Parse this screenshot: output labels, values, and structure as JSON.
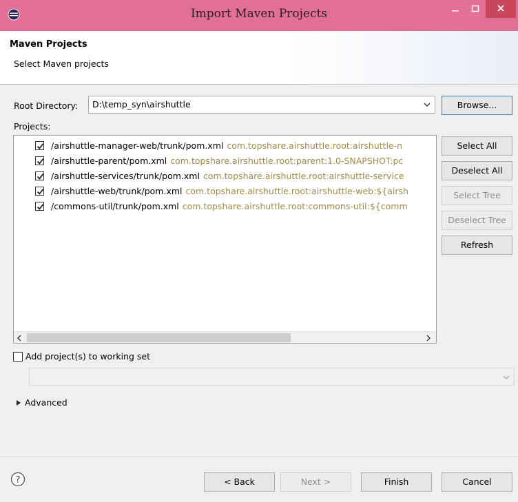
{
  "window": {
    "title": "Import Maven Projects"
  },
  "header": {
    "title": "Maven Projects",
    "subtitle": "Select Maven projects"
  },
  "root_directory": {
    "label": "Root Directory:",
    "value": "D:\\temp_syn\\airshuttle",
    "browse_label": "Browse..."
  },
  "projects": {
    "label": "Projects:",
    "items": [
      {
        "path": "/airshuttle-manager-web/trunk/pom.xml",
        "artifact": "com.topshare.airshuttle.root:airshuttle-n",
        "checked": true
      },
      {
        "path": "/airshuttle-parent/pom.xml",
        "artifact": "com.topshare.airshuttle.root:parent:1.0-SNAPSHOT:pc",
        "checked": true
      },
      {
        "path": "/airshuttle-services/trunk/pom.xml",
        "artifact": "com.topshare.airshuttle.root:airshuttle-service",
        "checked": true
      },
      {
        "path": "/airshuttle-web/trunk/pom.xml",
        "artifact": "com.topshare.airshuttle.root:airshuttle-web:${airsh",
        "checked": true
      },
      {
        "path": "/commons-util/trunk/pom.xml",
        "artifact": "com.topshare.airshuttle.root:commons-util:${comm",
        "checked": true
      }
    ]
  },
  "side_buttons": {
    "select_all": "Select All",
    "deselect_all": "Deselect All",
    "select_tree": "Select Tree",
    "deselect_tree": "Deselect Tree",
    "refresh": "Refresh"
  },
  "working_set": {
    "label": "Add project(s) to working set",
    "checked": false
  },
  "advanced": {
    "label": "Advanced"
  },
  "footer": {
    "back": "< Back",
    "next": "Next >",
    "finish": "Finish",
    "cancel": "Cancel"
  },
  "colors": {
    "titlebar": "#e26f94",
    "close_button": "#c8455c",
    "artifact_text": "#a08a4a"
  },
  "icons": {
    "app": "eclipse-icon",
    "help": "help-icon",
    "close": "close-icon",
    "minimize": "minimize-icon",
    "maximize": "maximize-icon"
  }
}
